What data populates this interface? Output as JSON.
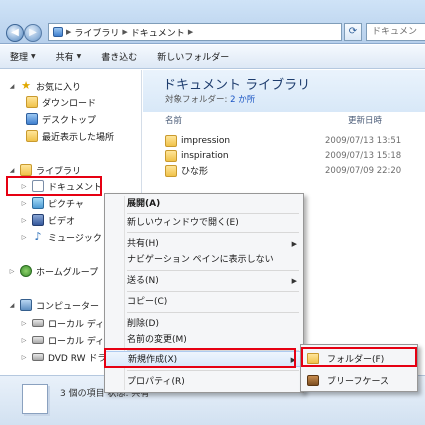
{
  "address": {
    "segments": [
      "ライブラリ",
      "ドキュメント"
    ],
    "search_placeholder": "ドキュメン"
  },
  "toolbar": {
    "organize": "整理",
    "share": "共有",
    "burn": "書き込む",
    "new_folder": "新しいフォルダー"
  },
  "nav": {
    "favorites": "お気に入り",
    "downloads": "ダウンロード",
    "desktop": "デスクトップ",
    "recent": "最近表示した場所",
    "libraries": "ライブラリ",
    "documents": "ドキュメント",
    "pictures": "ピクチャ",
    "videos": "ビデオ",
    "music": "ミュージック",
    "homegroup": "ホームグループ",
    "computer": "コンピューター",
    "local_disk1": "ローカル ディスク",
    "local_disk2": "ローカル ディスク",
    "dvd": "DVD RW ドライ"
  },
  "library": {
    "title": "ドキュメント ライブラリ",
    "target_label": "対象フォルダー: ",
    "target_link": "2 か所"
  },
  "columns": {
    "name": "名前",
    "date": "更新日時"
  },
  "files": [
    {
      "name": "impression",
      "date": "2009/07/13 13:51"
    },
    {
      "name": "inspiration",
      "date": "2009/07/13 15:18"
    },
    {
      "name": "ひな形",
      "date": "2009/07/09 22:20"
    }
  ],
  "details": {
    "text": "3 個の項目  状態: 共有"
  },
  "context_menu": {
    "expand": "展開(A)",
    "open_new_window": "新しいウィンドウで開く(E)",
    "share": "共有(H)",
    "hide_nav": "ナビゲーション ペインに表示しない",
    "send_to": "送る(N)",
    "copy": "コピー(C)",
    "delete": "削除(D)",
    "rename": "名前の変更(M)",
    "new": "新規作成(X)",
    "properties": "プロパティ(R)"
  },
  "submenu": {
    "folder": "フォルダー(F)",
    "briefcase": "ブリーフケース"
  },
  "colors": {
    "highlight_box": "#e60012",
    "link": "#1a55c4",
    "title": "#1e3d6e"
  }
}
